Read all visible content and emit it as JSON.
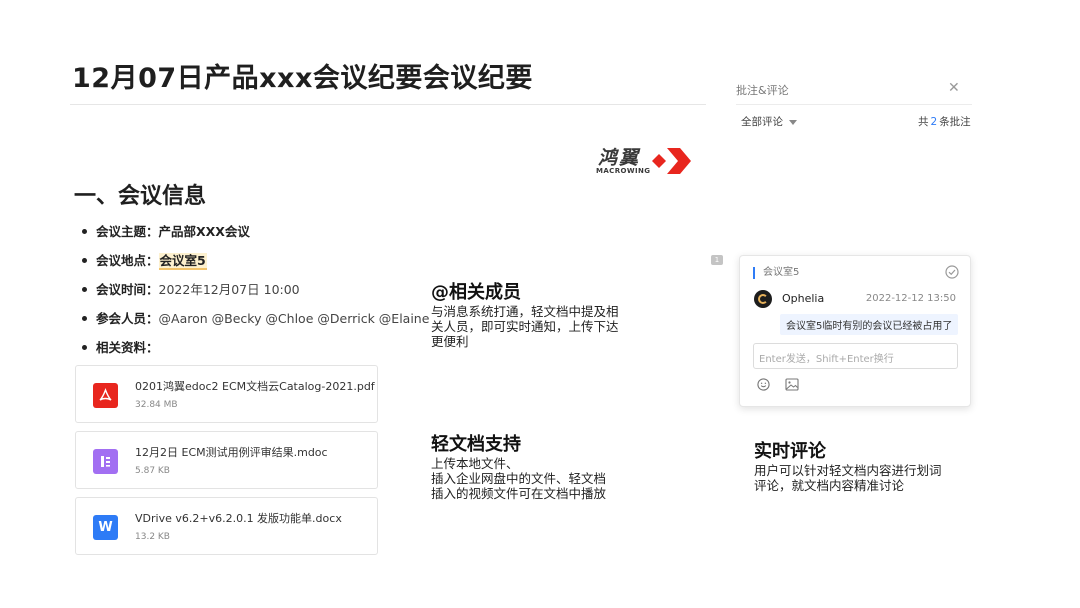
{
  "document": {
    "title": "12月07日产品xxx会议纪要会议纪要",
    "logo": {
      "cn": "鸿翼",
      "en": "MACROWING"
    },
    "section_heading": "一、会议信息",
    "info": [
      {
        "label": "会议主题：",
        "value": "产品部XXX会议"
      },
      {
        "label": "会议地点：",
        "value": "会议室5"
      },
      {
        "label": "会议时间：",
        "value": "2022年12月07日 10:00"
      },
      {
        "label": "参会人员：",
        "value": "@Aaron @Becky @Chloe @Derrick @Elaine"
      },
      {
        "label": "相关资料：",
        "value": ""
      }
    ],
    "files": [
      {
        "name": "0201鸿翼edoc2 ECM文档云Catalog-2021.pdf",
        "size": "32.84 MB",
        "icon": "pdf-icon",
        "color": "#e8261e"
      },
      {
        "name": "12月2日 ECM测试用例评审结果.mdoc",
        "size": "5.87 KB",
        "icon": "mdoc-icon",
        "color": "#9b6cf0"
      },
      {
        "name": "VDrive v6.2+v6.2.0.1 发版功能单.docx",
        "size": "13.2 KB",
        "icon": "word-icon",
        "color": "#2e7bf6"
      }
    ]
  },
  "callouts": {
    "mention": {
      "title": "@相关成员",
      "text": "与消息系统打通，轻文档中提及相\n关人员，即可实时通知，上传下达\n更便利"
    },
    "attachments": {
      "title": "轻文档支持",
      "text": "上传本地文件、\n插入企业网盘中的文件、轻文档\n插入的视频文件可在文档中播放"
    },
    "comments": {
      "title": "实时评论",
      "text": "用户可以针对轻文档内容进行划词\n评论，就文档内容精准讨论"
    }
  },
  "panel": {
    "title": "批注&评论",
    "filter": "全部评论",
    "count_prefix": "共",
    "count": "2",
    "count_suffix": "条批注",
    "marker": "1"
  },
  "comment": {
    "quote": "会议室5",
    "author": "Ophelia",
    "time": "2022-12-12 13:50",
    "text": "会议室5临时有别的会议已经被占用了",
    "input_placeholder": "Enter发送，Shift+Enter换行"
  },
  "colors": {
    "accent": "#2f7cf6",
    "logo_red": "#e8261e",
    "highlight": "#fdf1cf"
  }
}
